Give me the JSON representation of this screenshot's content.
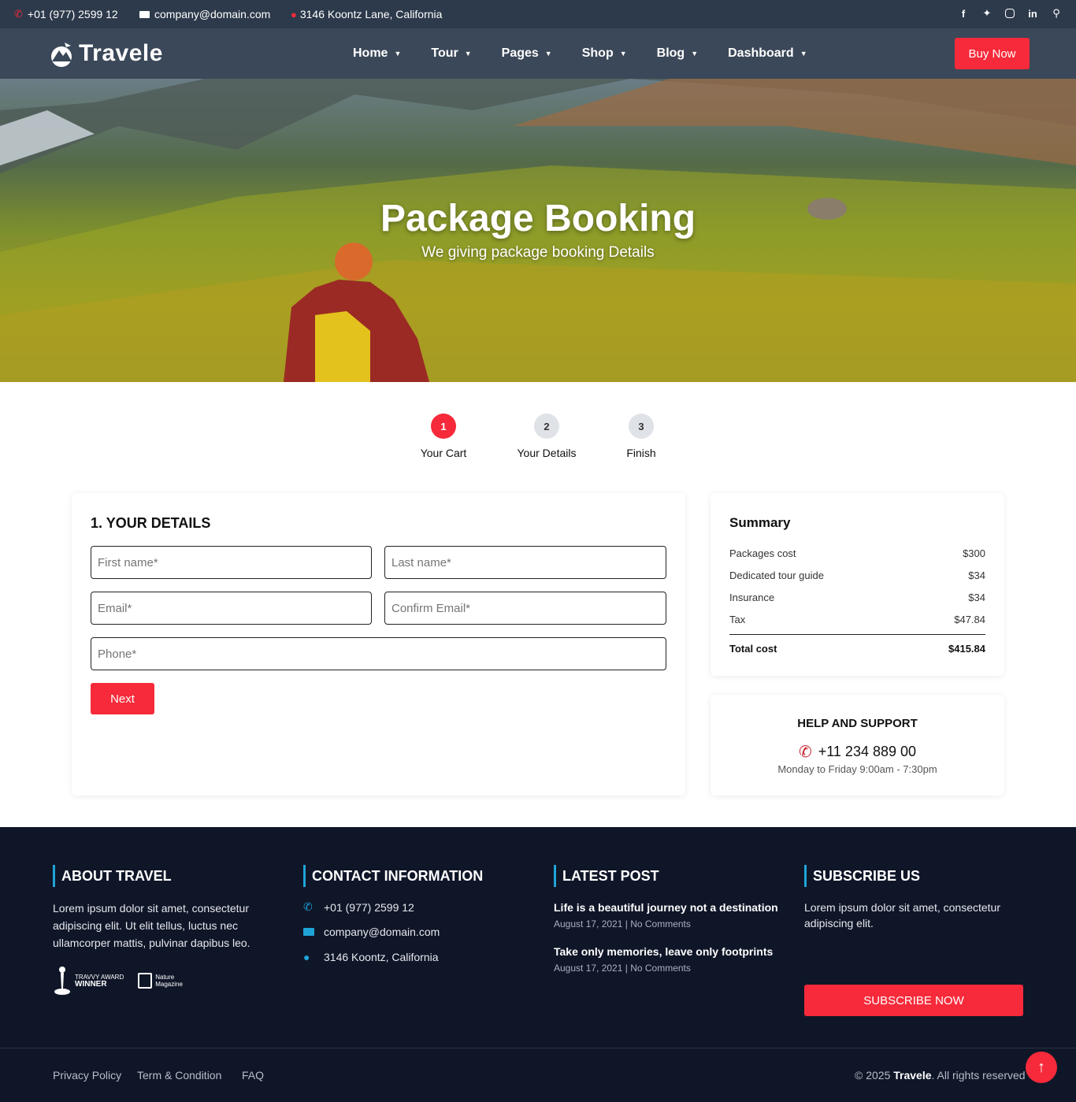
{
  "topbar": {
    "phone": "+01 (977) 2599 12",
    "email": "company@domain.com",
    "address": "3146 Koontz Lane, California",
    "socials": [
      "facebook-icon",
      "twitter-icon",
      "instagram-icon",
      "linkedin-icon",
      "search-icon"
    ]
  },
  "header": {
    "logo": "Travele",
    "nav": [
      {
        "label": "Home"
      },
      {
        "label": "Tour"
      },
      {
        "label": "Pages"
      },
      {
        "label": "Shop"
      },
      {
        "label": "Blog"
      },
      {
        "label": "Dashboard"
      }
    ],
    "buy_label": "Buy Now"
  },
  "hero": {
    "title": "Package Booking",
    "subtitle": "We giving package booking Details"
  },
  "steps": [
    {
      "number": "1",
      "label": "Your Cart"
    },
    {
      "number": "2",
      "label": "Your Details"
    },
    {
      "number": "3",
      "label": "Finish"
    }
  ],
  "details": {
    "title": "1. YOUR DETAILS",
    "first_name_placeholder": "First name*",
    "last_name_placeholder": "Last name*",
    "email_placeholder": "Email*",
    "confirm_email_placeholder": "Confirm Email*",
    "phone_placeholder": "Phone*",
    "next_label": "Next"
  },
  "summary": {
    "title": "Summary",
    "rows": [
      {
        "label": "Packages cost",
        "value": "$300"
      },
      {
        "label": "Dedicated tour guide",
        "value": "$34"
      },
      {
        "label": "Insurance",
        "value": "$34"
      },
      {
        "label": "Tax",
        "value": "$47.84"
      }
    ],
    "total_label": "Total cost",
    "total_value": "$415.84"
  },
  "help": {
    "title": "HELP AND SUPPORT",
    "phone": "+11 234 889 00",
    "hours": "Monday to Friday 9:00am - 7:30pm"
  },
  "footer": {
    "about_title": "ABOUT TRAVEL",
    "about_text": "Lorem ipsum dolor sit amet, consectetur adipiscing elit. Ut elit tellus, luctus nec ullamcorper mattis, pulvinar dapibus leo.",
    "badge1_line1": "TRAVVY AWARD",
    "badge1_line2": "WINNER",
    "badge2_line1": "Nature",
    "badge2_line2": "Magazine",
    "contact_title": "CONTACT INFORMATION",
    "contact_phone": "+01 (977) 2599 12",
    "contact_email": "company@domain.com",
    "contact_address": "3146 Koontz, California",
    "latest_title": "LATEST POST",
    "posts": [
      {
        "title": "Life is a beautiful journey not a destination",
        "date": "August 17, 2021",
        "comments": "No Comments"
      },
      {
        "title": "Take only memories, leave only footprints",
        "date": "August 17, 2021",
        "comments": "No Comments"
      }
    ],
    "subscribe_title": "SUBSCRIBE US",
    "subscribe_text": "Lorem ipsum dolor sit amet, consectetur adipiscing elit.",
    "subscribe_button": "SUBSCRIBE NOW",
    "links": [
      "Privacy Policy",
      "Term & Condition",
      "FAQ"
    ],
    "copyright_prefix": "© 2025",
    "copyright_brand": "Travele",
    "copyright_suffix": ". All rights reserved"
  },
  "colors": {
    "accent": "#f62a3a",
    "topbar": "#2d3a4b",
    "header": "#3b4859",
    "footer": "#0f1628",
    "footer_accent": "#1fa4d8"
  }
}
